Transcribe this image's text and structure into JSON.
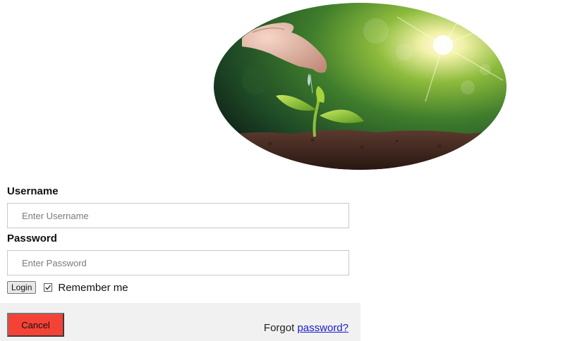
{
  "avatar": {
    "description_icon": "seedling-image"
  },
  "form": {
    "username_label": "Username",
    "username_placeholder": "Enter Username",
    "username_value": "",
    "password_label": "Password",
    "password_placeholder": "Enter Password",
    "password_value": "",
    "login_label": "Login",
    "remember_label": "Remember me",
    "remember_checked": true
  },
  "footer": {
    "cancel_label": "Cancel",
    "forgot_prefix": "Forgot ",
    "forgot_link": "password?"
  },
  "colors": {
    "cancel_bg": "#f44336",
    "footer_bg": "#f1f1f1",
    "link": "#1a1acc"
  }
}
